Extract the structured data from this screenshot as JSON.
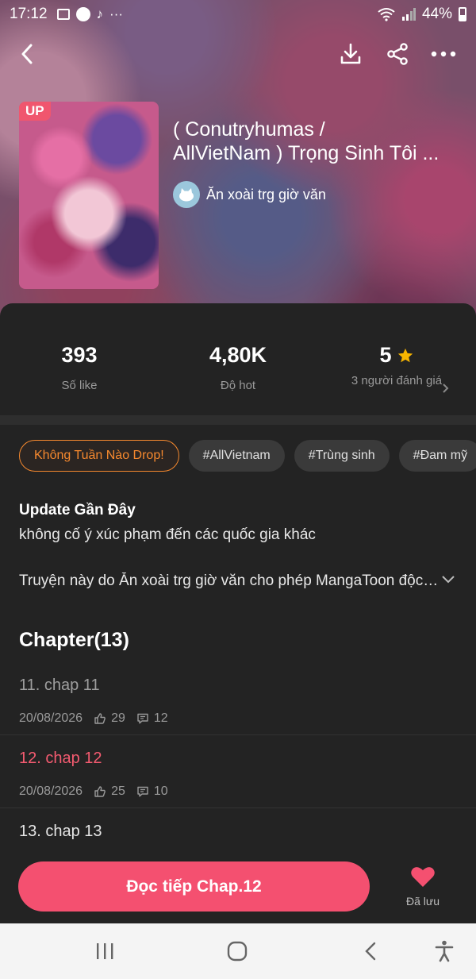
{
  "status_bar": {
    "time": "17:12",
    "battery": "44%"
  },
  "comic": {
    "badge": "UP",
    "title_line1": "( Conutryhumas /",
    "title_line2": "AllVietNam ) Trọng Sinh Tôi ...",
    "author": "Ăn xoài trg giờ văn"
  },
  "stats": {
    "likes_value": "393",
    "likes_label": "Số like",
    "hot_value": "4,80K",
    "hot_label": "Độ hot",
    "rating_value": "5",
    "rating_label": "3 người đánh giá"
  },
  "tags": [
    "Không Tuần Nào Drop!",
    "#AllVietnam",
    "#Trùng sinh",
    "#Đam mỹ"
  ],
  "update": {
    "title": "Update Gần Đây",
    "text": "không cố ý xúc phạm đến các quốc gia khác"
  },
  "description": "Truyện này do Ăn xoài trg giờ văn  cho phép MangaToon độc quyền đăng tải",
  "chapters_header": "Chapter(13)",
  "chapters": [
    {
      "title": "11. chap 11",
      "date": "20/08/2026",
      "likes": "29",
      "comments": "12"
    },
    {
      "title": "12. chap 12",
      "date": "20/08/2026",
      "likes": "25",
      "comments": "10"
    },
    {
      "title": "13. chap 13"
    }
  ],
  "bottom": {
    "read_button": "Đọc tiếp Chap.12",
    "saved_label": "Đã lưu"
  },
  "colors": {
    "accent": "#f45070",
    "tag_highlight": "#f6892e",
    "star": "#f7b500"
  }
}
